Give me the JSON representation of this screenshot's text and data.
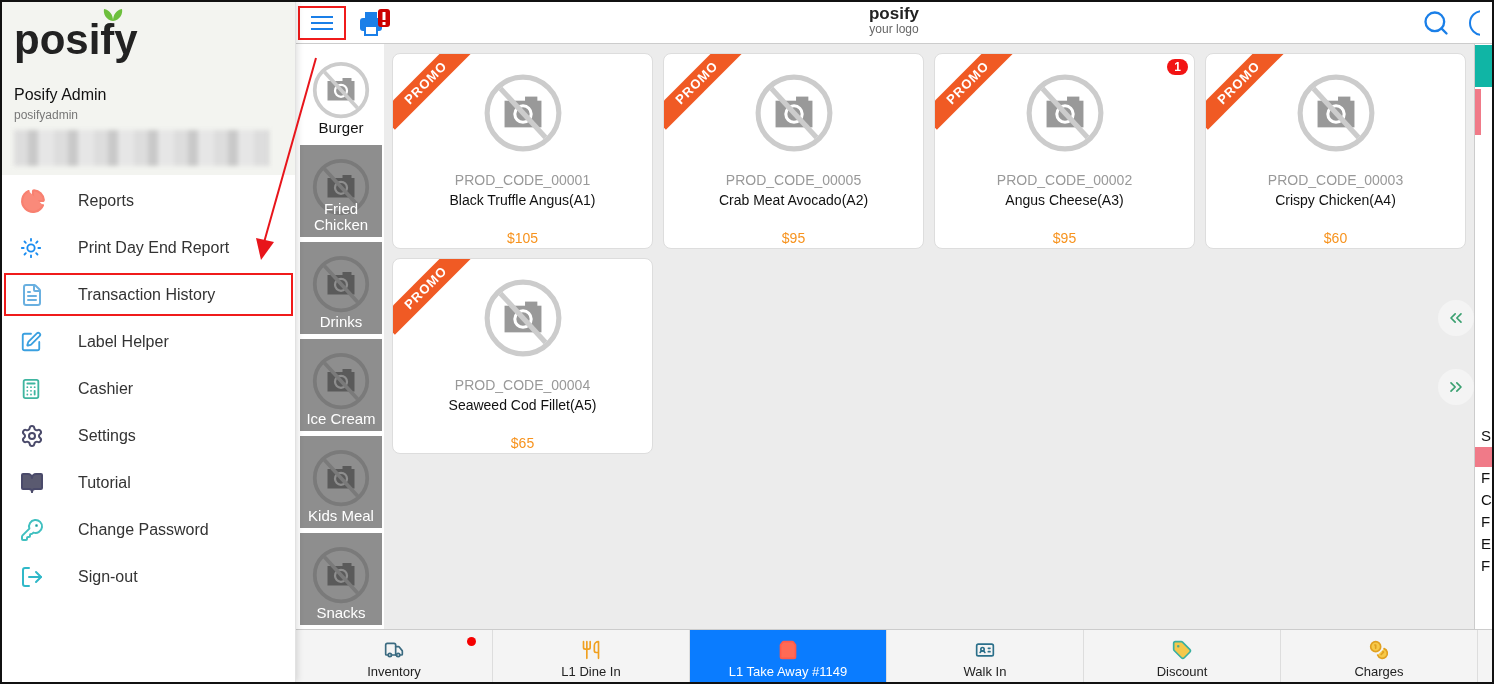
{
  "sidebar": {
    "brand": "posify",
    "user_name": "Posify Admin",
    "username": "posifyadmin",
    "menu": [
      {
        "label": "Reports",
        "highlighted": false
      },
      {
        "label": "Print Day End Report",
        "highlighted": false
      },
      {
        "label": "Transaction History",
        "highlighted": true
      },
      {
        "label": "Label Helper",
        "highlighted": false
      },
      {
        "label": "Cashier",
        "highlighted": false
      },
      {
        "label": "Settings",
        "highlighted": false
      },
      {
        "label": "Tutorial",
        "highlighted": false
      },
      {
        "label": "Change Password",
        "highlighted": false
      },
      {
        "label": "Sign-out",
        "highlighted": false
      }
    ]
  },
  "topbar": {
    "menu_highlighted": true,
    "logo_brand": "posify",
    "logo_sub": "your logo"
  },
  "categories": [
    {
      "label": "Burger",
      "selected": true
    },
    {
      "label": "Fried Chicken",
      "selected": false
    },
    {
      "label": "Drinks",
      "selected": false
    },
    {
      "label": "Ice Cream",
      "selected": false
    },
    {
      "label": "Kids Meal",
      "selected": false
    },
    {
      "label": "Snacks",
      "selected": false
    }
  ],
  "products": [
    {
      "ribbon": "PROMO",
      "code": "PROD_CODE_00001",
      "name": "Black Truffle Angus(A1)",
      "price": "$105"
    },
    {
      "ribbon": "PROMO",
      "code": "PROD_CODE_00005",
      "name": "Crab Meat Avocado(A2)",
      "price": "$95"
    },
    {
      "ribbon": "PROMO",
      "badge": "1",
      "code": "PROD_CODE_00002",
      "name": "Angus Cheese(A3)",
      "price": "$95"
    },
    {
      "ribbon": "PROMO",
      "code": "PROD_CODE_00003",
      "name": "Crispy Chicken(A4)",
      "price": "$60"
    },
    {
      "ribbon": "PROMO",
      "code": "PROD_CODE_00004",
      "name": "Seaweed Cod Fillet(A5)",
      "price": "$65"
    }
  ],
  "order_tabs": [
    {
      "label": "Inventory",
      "selected": false,
      "alert": true
    },
    {
      "label": "L1 Dine In",
      "selected": false,
      "alert": false
    },
    {
      "label": "L1 Take Away #1149",
      "selected": true,
      "alert": false
    },
    {
      "label": "Walk In",
      "selected": false,
      "alert": false
    },
    {
      "label": "Discount",
      "selected": false,
      "alert": false
    },
    {
      "label": "Charges",
      "selected": false,
      "alert": false
    }
  ],
  "side_panel": {
    "lines": [
      "S",
      "F",
      "C",
      "F",
      "E",
      "F"
    ]
  }
}
